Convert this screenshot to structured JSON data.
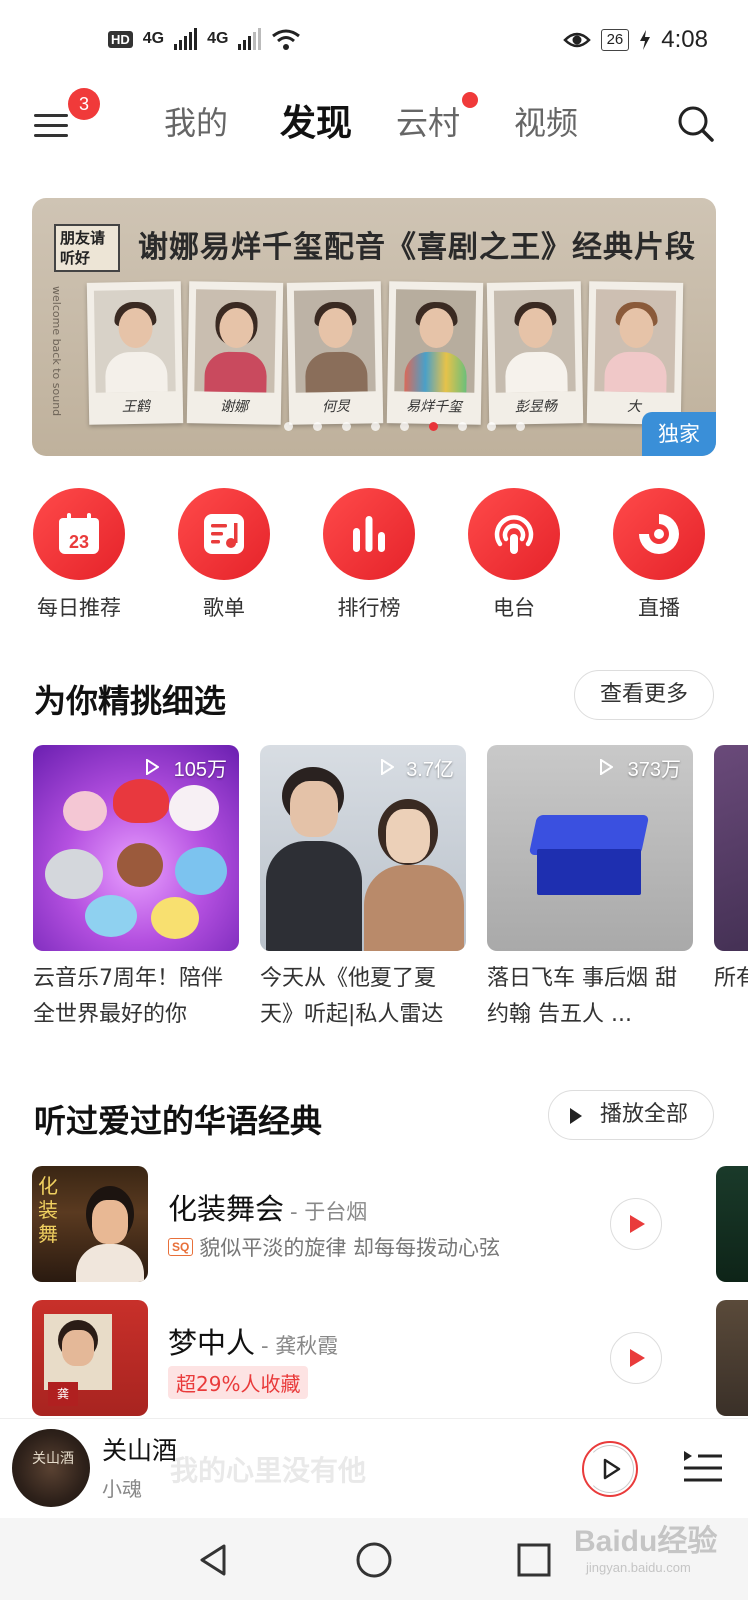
{
  "status_bar": {
    "hd": "HD",
    "net1": "4G",
    "net2": "4G",
    "battery": "26",
    "time": "4:08"
  },
  "top_nav": {
    "menu_badge": "3",
    "tabs": [
      {
        "label": "我的",
        "active": false
      },
      {
        "label": "发现",
        "active": true
      },
      {
        "label": "云村",
        "active": false,
        "dot": true
      },
      {
        "label": "视频",
        "active": false
      }
    ]
  },
  "banner": {
    "tag": "朋友请听好",
    "title": "谢娜易烊千玺配音《喜剧之王》经典片段",
    "side_text": "welcome back to sound",
    "signatures": [
      "王鹤",
      "谢娜",
      "何炅",
      "易烊千玺",
      "彭昱畅",
      "大"
    ],
    "badge": "独家",
    "slide_count": 9,
    "active_slide": 6
  },
  "quick_entries": [
    {
      "label": "每日推荐",
      "icon": "calendar-icon",
      "day": "23"
    },
    {
      "label": "歌单",
      "icon": "playlist-icon"
    },
    {
      "label": "排行榜",
      "icon": "chart-bars-icon"
    },
    {
      "label": "电台",
      "icon": "radio-icon"
    },
    {
      "label": "直播",
      "icon": "live-icon"
    }
  ],
  "picks": {
    "title": "为你精挑细选",
    "more": "查看更多",
    "cards": [
      {
        "count": "105万",
        "title": "云音乐7周年！陪伴全世界最好的你"
      },
      {
        "count": "3.7亿",
        "title": "今天从《他夏了夏天》听起|私人雷达"
      },
      {
        "count": "373万",
        "title": "落日飞车 事后烟 甜约翰 告五人 ..."
      },
      {
        "count": "",
        "title": "所有另一"
      }
    ]
  },
  "classics": {
    "title": "听过爱过的华语经典",
    "play_all": "播放全部",
    "songs": [
      {
        "name": "化装舞会",
        "artist": "- 于台烟",
        "badge": "SQ",
        "sub": "貌似平淡的旋律 却每每拨动心弦"
      },
      {
        "name": "梦中人",
        "artist": "- 龚秋霞",
        "hot": "超29%人收藏"
      }
    ]
  },
  "mini_player": {
    "disc_text": "关山酒",
    "title": "关山酒",
    "artist": "小魂",
    "behind": "我的心里没有他"
  },
  "watermark": {
    "brand": "Baidu经验",
    "url": "jingyan.baidu.com"
  },
  "colors": {
    "accent": "#e93b3b",
    "badge_blue": "#3a8fd8"
  }
}
